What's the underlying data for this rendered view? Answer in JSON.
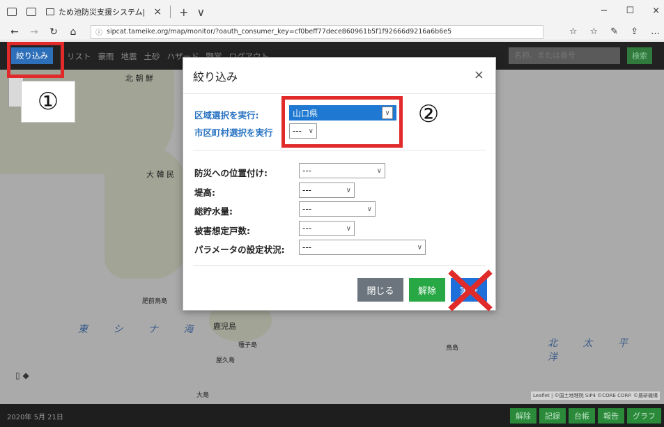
{
  "browser": {
    "tab_title": "ため池防災支援システム|",
    "tab_close": "×",
    "tab_new": "+",
    "tab_menu": "∨",
    "url": "sipcat.tameike.org/map/monitor/?oauth_consumer_key=cf0beff77dece860961b5f1f92666d9216a6b6e5",
    "window_controls": [
      "−",
      "☐",
      "×"
    ],
    "nav": {
      "back": "←",
      "forward": "→",
      "refresh": "↻",
      "home": "⌂"
    },
    "address_icons": [
      "☆",
      "☆",
      "✎",
      "⇪",
      "…"
    ]
  },
  "app": {
    "filter_button": "絞り込み",
    "nav_links": [
      "リスト",
      "豪雨",
      "地震",
      "土砂",
      "ハザード",
      "野営",
      "ログアウト"
    ],
    "search_placeholder": "名称、または番号",
    "search_button": "検索"
  },
  "map": {
    "labels": [
      "北 朝 鮮",
      "大 韓 民",
      "肥前鳥島",
      "鹿児島",
      "種子島",
      "屋久島",
      "大島",
      "鳥島"
    ],
    "sea_labels": [
      "東 シ ナ 海",
      "北 太 平 洋"
    ],
    "attribution": "Leaflet | ©国土地理院 SIP4 ©CORE CORP. ©農研機構"
  },
  "bottom": {
    "date": "2020年 5月 21日",
    "buttons": [
      "解除",
      "記録",
      "台帳",
      "報告",
      "グラフ"
    ]
  },
  "modal": {
    "title": "絞り込み",
    "close_icon": "×",
    "region_label": "区域選択を実行:",
    "region_value": "山口県",
    "city_label": "市区町村選択を実行",
    "city_value": "---",
    "fields": [
      {
        "label": "防災への位置付け:",
        "value": "---"
      },
      {
        "label": "堤高:",
        "value": "---"
      },
      {
        "label": "総貯水量:",
        "value": "---"
      },
      {
        "label": "被害想定戸数:",
        "value": "---"
      },
      {
        "label": "パラメータの設定状況:",
        "value": "---"
      }
    ],
    "btn_close": "閉じる",
    "btn_reset": "解除",
    "btn_exec": "実行"
  },
  "annotations": {
    "step1": "①",
    "step2": "②",
    "highlight_color": "#e12b2b"
  }
}
